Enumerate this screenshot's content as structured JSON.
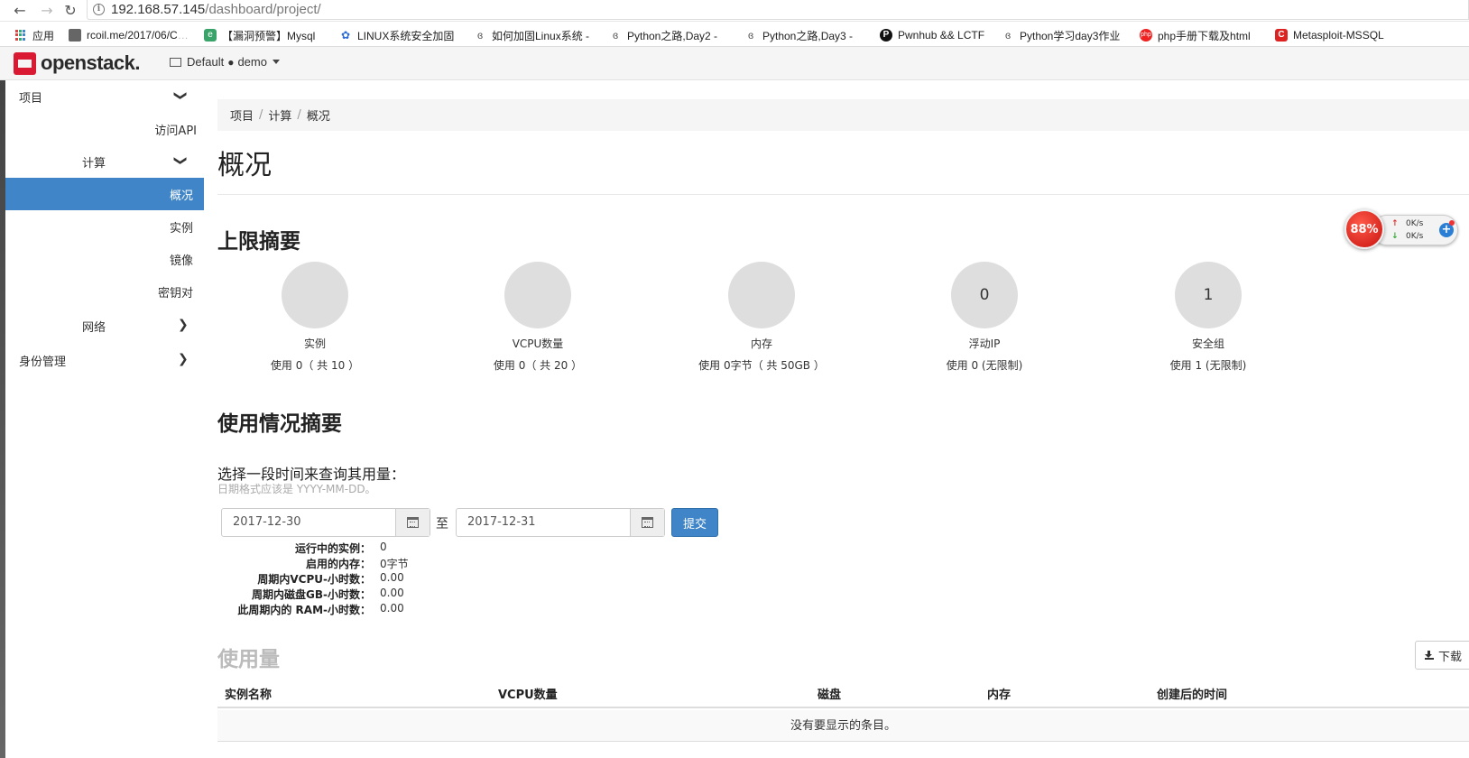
{
  "browser": {
    "url_host": "192.168.57.145",
    "url_path": "/dashboard/project/",
    "bookmarks": [
      {
        "label": "应用",
        "icon": "apps-grid-icon"
      },
      {
        "label": "rcoil.me/2017/06/C",
        "icon": "page-icon"
      },
      {
        "label": "【漏洞预警】Mysql",
        "icon": "e-icon"
      },
      {
        "label": "LINUX系统安全加固",
        "icon": "paw-icon"
      },
      {
        "label": "如何加固Linux系统 -",
        "icon": "blog-icon"
      },
      {
        "label": "Python之路,Day2 - ",
        "icon": "blog-icon"
      },
      {
        "label": "Python之路,Day3 - ",
        "icon": "blog-icon"
      },
      {
        "label": "Pwnhub && LCTF",
        "icon": "p-circle-icon"
      },
      {
        "label": "Python学习day3作业",
        "icon": "blog-icon"
      },
      {
        "label": "php手册下载及html",
        "icon": "php-icon"
      },
      {
        "label": "Metasploit-MSSQL",
        "icon": "c-icon"
      }
    ]
  },
  "header": {
    "logo_text": "openstack.",
    "domain": "Default",
    "dot": "●",
    "project": "demo"
  },
  "sidebar": {
    "project": "项目",
    "api_access": "访问API",
    "compute": "计算",
    "overview": "概况",
    "instances": "实例",
    "images": "镜像",
    "keypairs": "密钥对",
    "network": "网络",
    "identity": "身份管理"
  },
  "breadcrumb": [
    "项目",
    "计算",
    "概况"
  ],
  "breadcrumb_sep": "/",
  "page_title": "概况",
  "limit_summary": {
    "title": "上限摘要",
    "items": [
      {
        "name": "实例",
        "usage": "使用 0（ 共 10 ）",
        "center": ""
      },
      {
        "name": "VCPU数量",
        "usage": "使用 0（ 共 20 ）",
        "center": ""
      },
      {
        "name": "内存",
        "usage": "使用 0字节（ 共 50GB ）",
        "center": ""
      },
      {
        "name": "浮动IP",
        "usage": "使用 0 (无限制)",
        "center": "0"
      },
      {
        "name": "安全组",
        "usage": "使用 1 (无限制)",
        "center": "1"
      }
    ]
  },
  "usage_summary": {
    "title": "使用情况摘要",
    "form_label": "选择一段时间来查询其用量：",
    "form_help": "日期格式应该是 YYYY-MM-DD。",
    "start_date": "2017-12-30",
    "to_label": "至",
    "end_date": "2017-12-31",
    "submit": "提交",
    "stats": [
      {
        "key": "运行中的实例：",
        "value": "0"
      },
      {
        "key": "启用的内存：",
        "value": "0字节"
      },
      {
        "key": "周期内VCPU-小时数：",
        "value": "0.00"
      },
      {
        "key": "周期内磁盘GB-小时数：",
        "value": "0.00"
      },
      {
        "key": "此周期内的 RAM-小时数：",
        "value": "0.00"
      }
    ]
  },
  "usage": {
    "title": "使用量",
    "download": "下载",
    "columns": [
      "实例名称",
      "VCPU数量",
      "磁盘",
      "内存",
      "创建后的时间"
    ],
    "empty": "没有要显示的条目。"
  },
  "widget": {
    "percent": "88%",
    "up_speed": "0K/s",
    "down_speed": "0K/s",
    "up_arrow": "↑",
    "down_arrow": "↓",
    "plus": "+"
  },
  "colors": {
    "accent": "#3f85c7",
    "brand": "#da1a32"
  }
}
